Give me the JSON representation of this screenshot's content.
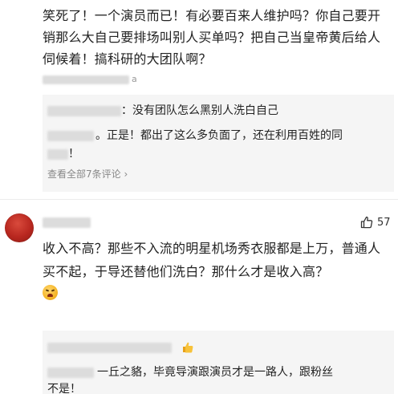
{
  "comment1": {
    "text": "笑死了！一个演员而已！有必要百来人维护吗？你自己要开销那么大自己要排场叫别人买单吗？把自己当皇帝黄后给人伺候着！搞科研的大团队啊？",
    "meta_tail": "a",
    "replies": [
      {
        "suffix": "：没有团队怎么黑别人洗白自己"
      },
      {
        "line1": "。正是！都出了这么多负面了，还在利用百姓的同",
        "line2": "！"
      }
    ],
    "view_all": "查看全部7条评论",
    "view_all_arrow": "›"
  },
  "comment2": {
    "likes": "57",
    "text": "收入不高？那些不入流的明星机场秀衣服都是上万，普通人买不起，于导还替他们洗白？那什么才是收入高？",
    "replies": [
      {
        "line1": "一丘之貉，毕竟导演跟演员才是一路人，跟粉丝",
        "line2": "不是！"
      }
    ]
  },
  "colors": {
    "text": "#222222",
    "reply_bg": "#f5f5f5",
    "muted": "#888888",
    "avatar": "#c0392b"
  },
  "icons": {
    "like": "thumbs-up-outline-icon",
    "emoji_angry": "angry-face-emoji-icon",
    "emoji_thumb": "thumbs-up-emoji-icon"
  }
}
